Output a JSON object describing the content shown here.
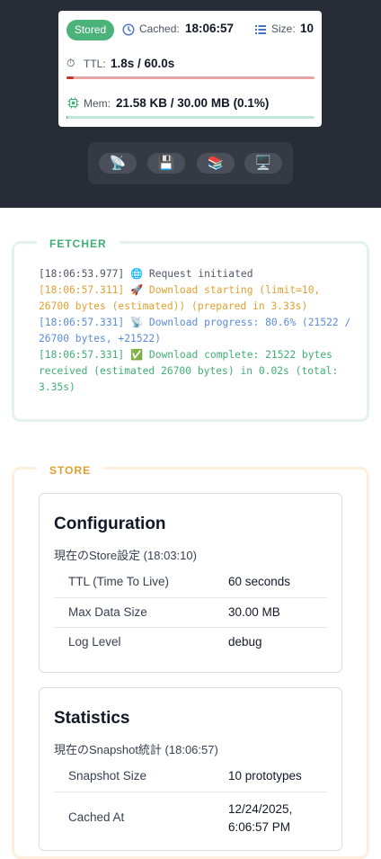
{
  "status": {
    "badge": "Stored",
    "cached_label": "Cached:",
    "cached_time": "18:06:57",
    "size_label": "Size:",
    "size_value": "10",
    "ttl_label": "TTL:",
    "ttl_value": "1.8s / 60.0s",
    "ttl_fraction": 0.03,
    "mem_label": "Mem:",
    "mem_value": "21.58 KB / 30.00 MB (0.1%)",
    "mem_fraction": 0.001
  },
  "toolbar": {
    "buttons": [
      "📡",
      "💾",
      "📚",
      "🖥️"
    ]
  },
  "fetcher": {
    "title": "FETCHER",
    "logs": [
      {
        "text": "[18:06:53.977] 🌐 Request initiated",
        "color": "#4b5563"
      },
      {
        "text": "[18:06:57.311] 🚀 Download starting (limit=10, 26700 bytes (estimated)) (prepared in 3.33s)",
        "color": "#e0a030"
      },
      {
        "text": "[18:06:57.331] 📡 Download progress: 80.6% (21522 / 26700 bytes, +21522)",
        "color": "#5b8bd8"
      },
      {
        "text": "[18:06:57.331] ✅ Download complete: 21522 bytes received (estimated 26700 bytes) in 0.02s (total: 3.35s)",
        "color": "#3fae74"
      }
    ]
  },
  "store": {
    "title": "STORE",
    "configuration": {
      "heading": "Configuration",
      "caption": "現在のStore設定 (18:03:10)",
      "rows": [
        {
          "key": "TTL (Time To Live)",
          "value": "60 seconds"
        },
        {
          "key": "Max Data Size",
          "value": "30.00 MB"
        },
        {
          "key": "Log Level",
          "value": "debug"
        }
      ]
    },
    "statistics": {
      "heading": "Statistics",
      "caption": "現在のSnapshot統計 (18:06:57)",
      "rows": [
        {
          "key": "Snapshot Size",
          "value": "10 prototypes"
        },
        {
          "key": "Cached At",
          "value": "12/24/2025, 6:06:57 PM"
        }
      ]
    }
  },
  "colors": {
    "dark_bg": "#272c36",
    "stored": "#4bb37a",
    "ttl_bar": "#e8a3a3",
    "ttl_fill": "#c0392b",
    "mem_bar": "#bfe6d7",
    "fetcher_border": "#e3f3ec",
    "store_border": "#fdeedd"
  }
}
